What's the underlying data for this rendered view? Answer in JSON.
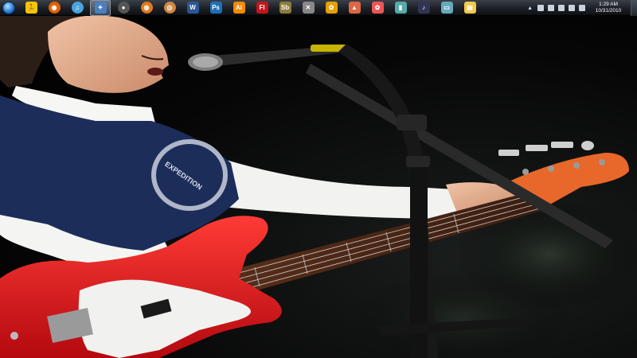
{
  "taskbar": {
    "start_button": {
      "icon": "windows-orb-icon"
    },
    "pinned_apps": [
      {
        "icon": "aim-icon",
        "color": "#f5c400",
        "glyph": "🏃"
      },
      {
        "icon": "firefox-icon",
        "color": "#e66000",
        "glyph": "◉"
      },
      {
        "icon": "itunes-icon",
        "color": "#4aa3df",
        "glyph": "♫"
      },
      {
        "icon": "active-window-icon",
        "color": "#4a7fc0",
        "glyph": "✦",
        "active": true
      },
      {
        "icon": "media-player-icon",
        "color": "#555",
        "glyph": "●"
      },
      {
        "icon": "browser-icon",
        "color": "#e07a1f",
        "glyph": "◍"
      },
      {
        "icon": "picasa-icon",
        "color": "#c84",
        "glyph": "◎"
      },
      {
        "icon": "word-icon",
        "color": "#2b5797",
        "glyph": "W"
      },
      {
        "icon": "photoshop-icon",
        "color": "#1f6fb5",
        "glyph": "Ps"
      },
      {
        "icon": "illustrator-icon",
        "color": "#f28a00",
        "glyph": "Ai"
      },
      {
        "icon": "flash-icon",
        "color": "#c4161c",
        "glyph": "Fl"
      },
      {
        "icon": "soundbooth-icon",
        "color": "#8f7c3a",
        "glyph": "Sb"
      },
      {
        "icon": "tool-icon",
        "color": "#888",
        "glyph": "✕"
      },
      {
        "icon": "fl-studio-icon",
        "color": "#e8a000",
        "glyph": "✿"
      },
      {
        "icon": "game-icon",
        "color": "#d64",
        "glyph": "▲"
      },
      {
        "icon": "network-icon",
        "color": "#e55",
        "glyph": "✿"
      },
      {
        "icon": "bottle-icon",
        "color": "#5aa",
        "glyph": "▮"
      },
      {
        "icon": "guitar-app-icon",
        "color": "#335",
        "glyph": "♪"
      },
      {
        "icon": "display-icon",
        "color": "#6ab",
        "glyph": "▭"
      },
      {
        "icon": "folder-icon",
        "color": "#f2c84b",
        "glyph": "▤"
      }
    ]
  },
  "tray": {
    "icons": [
      "show-hidden-icon",
      "bluetooth-icon",
      "network-icon",
      "battery-icon",
      "signal-icon",
      "volume-icon"
    ],
    "time": "1:29 AM",
    "date": "10/31/2010"
  },
  "wallpaper": {
    "description_icon": "photo-wallpaper",
    "shirt_print": "EXPEDITION"
  },
  "colors": {
    "taskbar_top": "#3a4048",
    "guitar_body": "#d8171c",
    "shirt": "#1d2d5a"
  }
}
